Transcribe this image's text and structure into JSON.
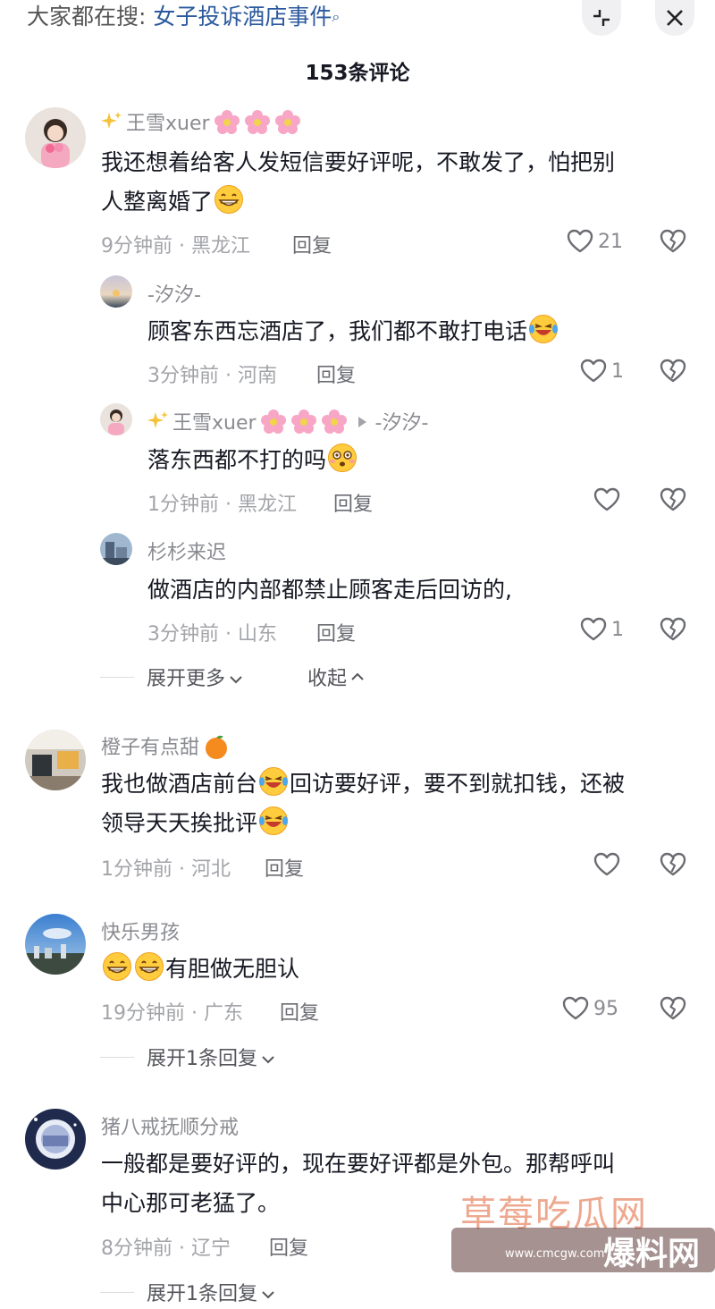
{
  "header": {
    "search_prefix": "大家都在搜: ",
    "search_topic": "女子投诉酒店事件",
    "comment_count": "153条评论"
  },
  "comments": [
    {
      "user": "王雪xuer",
      "text_a": "我还想着给客人发短信要好评呢，不敢发了，怕把别",
      "text_b": "人整离婚了",
      "time": "9分钟前 · 黑龙江",
      "reply": "回复",
      "likes": "21"
    },
    {
      "user": "橙子有点甜",
      "text_a1": "我也做酒店前台",
      "text_a2": "回访要好评，要不到就扣钱，还被",
      "text_b": "领导天天挨批评",
      "time": "1分钟前 · 河北",
      "reply": "回复",
      "likes": ""
    },
    {
      "user": "快乐男孩",
      "text": "有胆做无胆认",
      "time": "19分钟前 · 广东",
      "reply": "回复",
      "likes": "95",
      "expand": "展开1条回复"
    },
    {
      "user": "猪八戒抚顺分戒",
      "text_a": "一般都是要好评的，现在要好评都是外包。那帮呼叫",
      "text_b": "中心那可老猛了。",
      "time": "8分钟前 · 辽宁",
      "reply": "回复",
      "expand": "展开1条回复"
    }
  ],
  "replies": [
    {
      "user": "-汐汐-",
      "text": "顾客东西忘酒店了，我们都不敢打电话",
      "time": "3分钟前 · 河南",
      "reply": "回复",
      "likes": "1"
    },
    {
      "user": "王雪xuer",
      "reply_to": "-汐汐-",
      "text": "落东西都不打的吗",
      "time": "1分钟前 · 黑龙江",
      "reply": "回复",
      "likes": ""
    },
    {
      "user": "杉杉来迟",
      "text": "做酒店的内部都禁止顾客走后回访的,",
      "time": "3分钟前 · 山东",
      "reply": "回复",
      "likes": "1"
    }
  ],
  "thread_controls": {
    "expand_more": "展开更多",
    "collapse": "收起"
  },
  "watermark": {
    "title": "草莓吃瓜网",
    "url": "www.cmcgw.com",
    "big": "爆料网"
  },
  "icons": [
    "search-icon",
    "minimize-icon",
    "close-icon",
    "heart-icon",
    "dislike-heart-icon",
    "grin-emoji",
    "laugh-cry-emoji",
    "dizzy-emoji",
    "flower-emoji",
    "sparkle-emoji",
    "orange-emoji"
  ]
}
